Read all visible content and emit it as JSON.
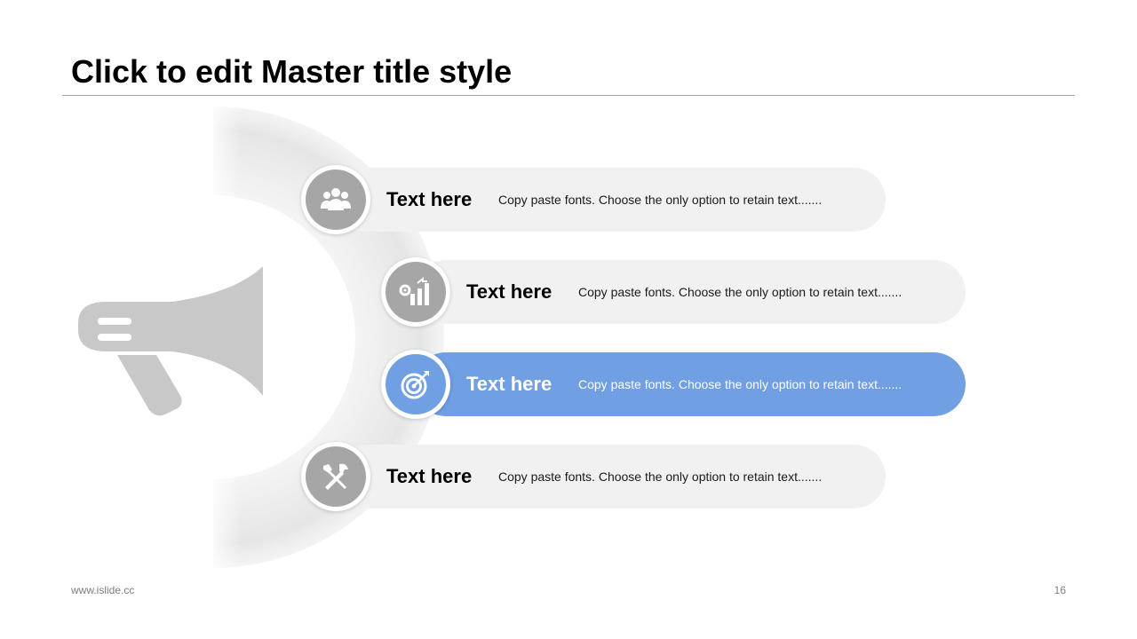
{
  "slide": {
    "title": "Click to edit Master title style",
    "footer_left": "www.islide.cc",
    "page_number": "16"
  },
  "colors": {
    "accent": "#709fe3",
    "neutral": "#a6a6a6",
    "row_bg": "#f1f1f1"
  },
  "rows": [
    {
      "title": "Text here",
      "description": "Copy paste fonts. Choose the only option to retain text.......",
      "icon": "team-icon",
      "active": false
    },
    {
      "title": "Text here",
      "description": "Copy paste fonts. Choose the only option to retain text.......",
      "icon": "growth-chart-gear-icon",
      "active": false
    },
    {
      "title": "Text here",
      "description": "Copy paste fonts. Choose the only option to retain text.......",
      "icon": "target-icon",
      "active": true
    },
    {
      "title": "Text here",
      "description": "Copy paste fonts. Choose the only option to retain text.......",
      "icon": "tools-icon",
      "active": false
    }
  ],
  "decor": {
    "main_icon": "megaphone-icon"
  }
}
